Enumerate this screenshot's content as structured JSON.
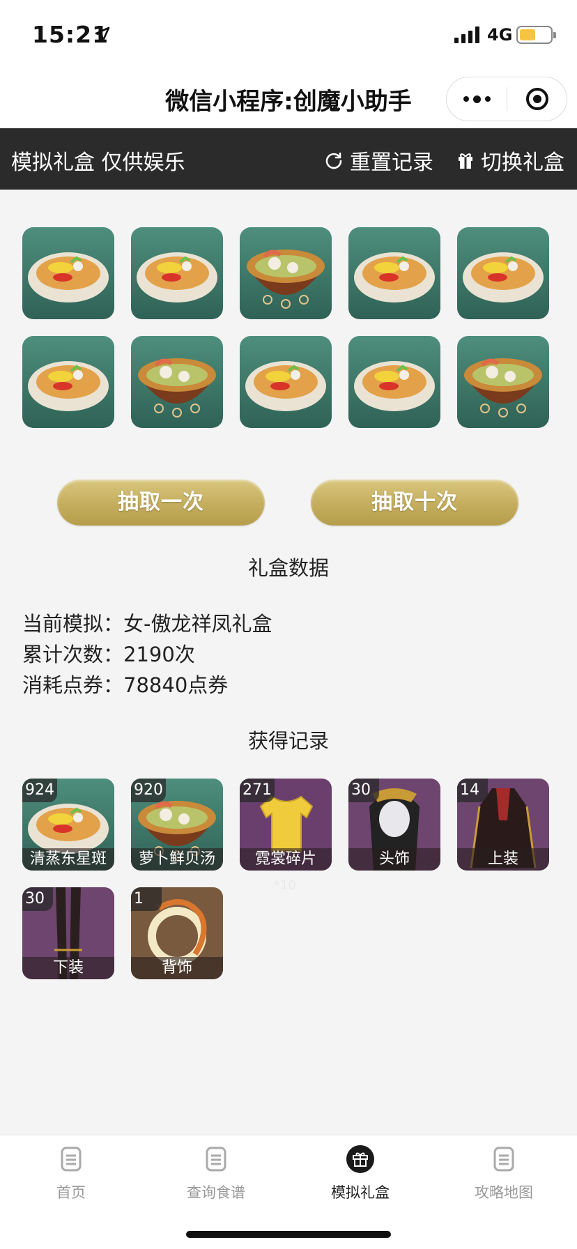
{
  "status_bar": {
    "time": "15:21",
    "network": "4G"
  },
  "title_bar": {
    "title": "微信小程序:创魔小助手"
  },
  "toolbar": {
    "left_label": "模拟礼盒 仅供娱乐",
    "reset_label": "重置记录",
    "switch_label": "切换礼盒"
  },
  "results": {
    "items": [
      "noodle",
      "noodle",
      "stew",
      "noodle",
      "noodle",
      "noodle",
      "stew",
      "noodle",
      "noodle",
      "stew"
    ]
  },
  "buttons": {
    "draw_once": "抽取一次",
    "draw_ten": "抽取十次"
  },
  "data_section": {
    "title": "礼盒数据",
    "current_label": "当前模拟：",
    "current_value": "女-傲龙祥凤礼盒",
    "count_label": "累计次数：",
    "count_value": "2190次",
    "cost_label": "消耗点券：",
    "cost_value": "78840点券"
  },
  "records": {
    "title": "获得记录",
    "ghost_text": "*10",
    "items": [
      {
        "count": "924",
        "label": "清蒸东星斑",
        "art": "noodle"
      },
      {
        "count": "920",
        "label": "萝卜鲜贝汤",
        "art": "stew"
      },
      {
        "count": "271",
        "label": "霓裳碎片",
        "art": "shirt"
      },
      {
        "count": "30",
        "label": "头饰",
        "art": "headwear"
      },
      {
        "count": "14",
        "label": "上装",
        "art": "top"
      },
      {
        "count": "30",
        "label": "下装",
        "art": "bottom"
      },
      {
        "count": "1",
        "label": "背饰",
        "art": "back"
      }
    ]
  },
  "tabbar": {
    "items": [
      {
        "label": "首页",
        "icon": "document-icon"
      },
      {
        "label": "查询食谱",
        "icon": "document-icon"
      },
      {
        "label": "模拟礼盒",
        "icon": "gift-icon",
        "active": true
      },
      {
        "label": "攻略地图",
        "icon": "document-icon"
      }
    ]
  },
  "colors": {
    "toolbar_bg": "#2b2b2b",
    "button_gold": "#c4ad5d",
    "page_bg": "#f4f4f4",
    "battery": "#f5c542"
  }
}
